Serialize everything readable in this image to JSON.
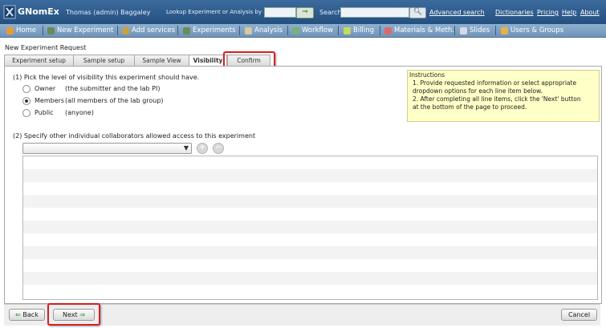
{
  "topbar": {
    "app_title": "GNomEx",
    "user": "Thomas (admin) Baggaley",
    "lookup_label": "Lookup Experiment or Analysis by #",
    "lookup_value": "",
    "search_label": "Search",
    "search_value": "",
    "links": {
      "advanced_search": "Advanced search",
      "dictionaries": "Dictionaries",
      "pricing": "Pricing",
      "help": "Help",
      "about": "About"
    }
  },
  "nav": {
    "items": [
      {
        "label": "Home",
        "icon": "home-icon"
      },
      {
        "label": "New Experiment",
        "icon": "flask-icon"
      },
      {
        "label": "Add services",
        "icon": "add-services-icon"
      },
      {
        "label": "Experiments",
        "icon": "flask-icon"
      },
      {
        "label": "Analysis",
        "icon": "chart-icon"
      },
      {
        "label": "Workflow",
        "icon": "workflow-icon"
      },
      {
        "label": "Billing",
        "icon": "billing-icon"
      },
      {
        "label": "Materials & Meth.",
        "icon": "materials-icon"
      },
      {
        "label": "Slides",
        "icon": "slides-icon"
      },
      {
        "label": "Users & Groups",
        "icon": "users-icon"
      }
    ]
  },
  "page_title": "New Experiment Request",
  "tabs": [
    {
      "label": "Experiment setup"
    },
    {
      "label": "Sample setup"
    },
    {
      "label": "Sample View"
    },
    {
      "label": "Visibility",
      "active": true
    },
    {
      "label": "Confirm",
      "highlighted": true
    }
  ],
  "visibility": {
    "question": "(1) Pick the level of visibility this experiment should have.",
    "options": [
      {
        "label": "Owner",
        "desc": "(the submitter and the lab PI)",
        "checked": false
      },
      {
        "label": "Members",
        "desc": "(all members of the lab group)",
        "checked": true
      },
      {
        "label": "Public",
        "desc": "(anyone)",
        "checked": false
      }
    ]
  },
  "instructions": {
    "title": "Instructions",
    "items": [
      "1.  Provide requested information or select appropriate dropdown options for each line item below.",
      "2.  After completing all line items, click the 'Next' button at the bottom of the page to proceed."
    ]
  },
  "collaborators": {
    "question": "(2) Specify other individual collaborators allowed access to this experiment",
    "selected": ""
  },
  "buttons": {
    "back": "Back",
    "next": "Next",
    "cancel": "Cancel"
  },
  "colors": {
    "topbar": "#2f5f92",
    "navbar": "#7fa2c4",
    "highlight": "#d52020",
    "instructions_bg": "#ffffc8",
    "grid_alt_row": "#f3f3f3"
  }
}
